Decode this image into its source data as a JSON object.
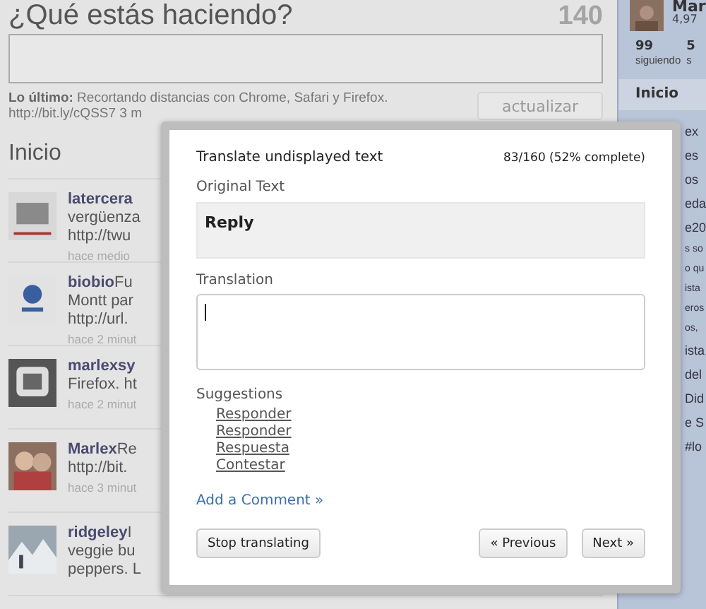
{
  "status_box": {
    "heading": "¿Qué estás haciendo?",
    "counter": "140",
    "latest_label": "Lo último:",
    "latest_text": "Recortando distancias con Chrome, Safari y Firefox.",
    "latest_link_line": "http://bit.ly/cQSS7 3 m",
    "update_button": "actualizar"
  },
  "timeline": {
    "title": "Inicio",
    "tweets": [
      {
        "user": "latercera",
        "lines": [
          "vergüenza",
          "http://twu"
        ],
        "time": "hace medio"
      },
      {
        "user": "biobio",
        "first": "Fu",
        "lines": [
          "Montt par",
          "http://url."
        ],
        "time": "hace 2 minut"
      },
      {
        "user": "marlexsy",
        "lines": [
          "Firefox. ht"
        ],
        "time": "hace 2 minut"
      },
      {
        "user": "Marlex",
        "first": "Re",
        "lines": [
          "http://bit."
        ],
        "time": "hace 3 minut"
      },
      {
        "user": "ridgeley",
        "first": "I",
        "lines": [
          "veggie bu",
          "peppers. L"
        ]
      }
    ]
  },
  "sidebar": {
    "name": "Mar",
    "count": "4,97",
    "stats": [
      {
        "value": "99",
        "label": "siguiendo"
      },
      {
        "value": "5",
        "label": "s"
      }
    ],
    "nav_item": "Inicio",
    "fragments": [
      {
        "text": "ex",
        "kind": "big"
      },
      {
        "text": "es",
        "kind": "big"
      },
      {
        "text": "os",
        "kind": "big"
      },
      {
        "text": "eda",
        "kind": "big"
      },
      {
        "text": "e20",
        "kind": "big"
      },
      {
        "text": "s so",
        "kind": "small"
      },
      {
        "text": "o qu",
        "kind": "small"
      },
      {
        "text": "ista",
        "kind": "small"
      },
      {
        "text": "eros",
        "kind": "small"
      },
      {
        "text": "os,",
        "kind": "small"
      },
      {
        "text": "ista",
        "kind": "big"
      },
      {
        "text": "del",
        "kind": "big"
      },
      {
        "text": "Did",
        "kind": "big"
      },
      {
        "text": "e S",
        "kind": "big"
      },
      {
        "text": "#lo",
        "kind": "big"
      }
    ]
  },
  "dialog": {
    "title": "Translate undisplayed text",
    "progress": "83/160 (52% complete)",
    "original_label": "Original Text",
    "original_text": "Reply",
    "translation_label": "Translation",
    "suggestions_label": "Suggestions",
    "suggestions": [
      "Responder",
      "Responder",
      "Respuesta",
      "Contestar"
    ],
    "comment_link": "Add a Comment »",
    "stop_button": "Stop translating",
    "previous_button": "« Previous",
    "next_button": "Next »"
  }
}
